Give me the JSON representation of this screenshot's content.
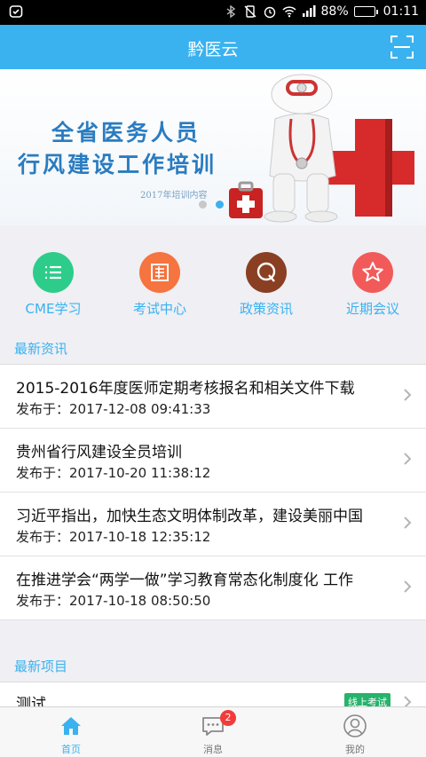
{
  "status_bar": {
    "battery": "88%",
    "time": "01:11",
    "battery_level": 0.88
  },
  "header": {
    "title": "黔医云"
  },
  "banner": {
    "line1": "全省医务人员",
    "line2": "行风建设工作培训",
    "sub": "2017年培训内容",
    "slide_count": 2,
    "active_slide": 2
  },
  "quick_links": [
    {
      "label": "CME学习",
      "icon": "list-icon",
      "color": "#2ecc8a"
    },
    {
      "label": "考试中心",
      "icon": "exam-sheet-icon",
      "color": "#f5743f"
    },
    {
      "label": "政策资讯",
      "icon": "q-icon",
      "color": "#8a3f22"
    },
    {
      "label": "近期会议",
      "icon": "star-icon",
      "color": "#f25a5a"
    }
  ],
  "news": {
    "section_title": "最新资讯",
    "items": [
      {
        "title": "2015-2016年度医师定期考核报名和相关文件下载",
        "date": "发布于：2017-12-08 09:41:33"
      },
      {
        "title": "贵州省行风建设全员培训",
        "date": "发布于：2017-10-20 11:38:12"
      },
      {
        "title": "习近平指出，加快生态文明体制改革，建设美丽中国",
        "date": "发布于：2017-10-18 12:35:12"
      },
      {
        "title": "在推进学会“两学一做”学习教育常态化制度化 工作",
        "date": "发布于：2017-10-18 08:50:50"
      }
    ]
  },
  "projects": {
    "section_title": "最新项目",
    "items": [
      {
        "title": "测试",
        "tag": "线上考试"
      }
    ]
  },
  "tabbar": {
    "items": [
      {
        "label": "首页",
        "icon": "home-icon",
        "active": true
      },
      {
        "label": "消息",
        "icon": "message-icon",
        "badge": "2"
      },
      {
        "label": "我的",
        "icon": "profile-icon"
      }
    ]
  },
  "colors": {
    "accent": "#3ab2ef",
    "tag_green": "#26b36b",
    "badge_red": "#f23b3b"
  }
}
